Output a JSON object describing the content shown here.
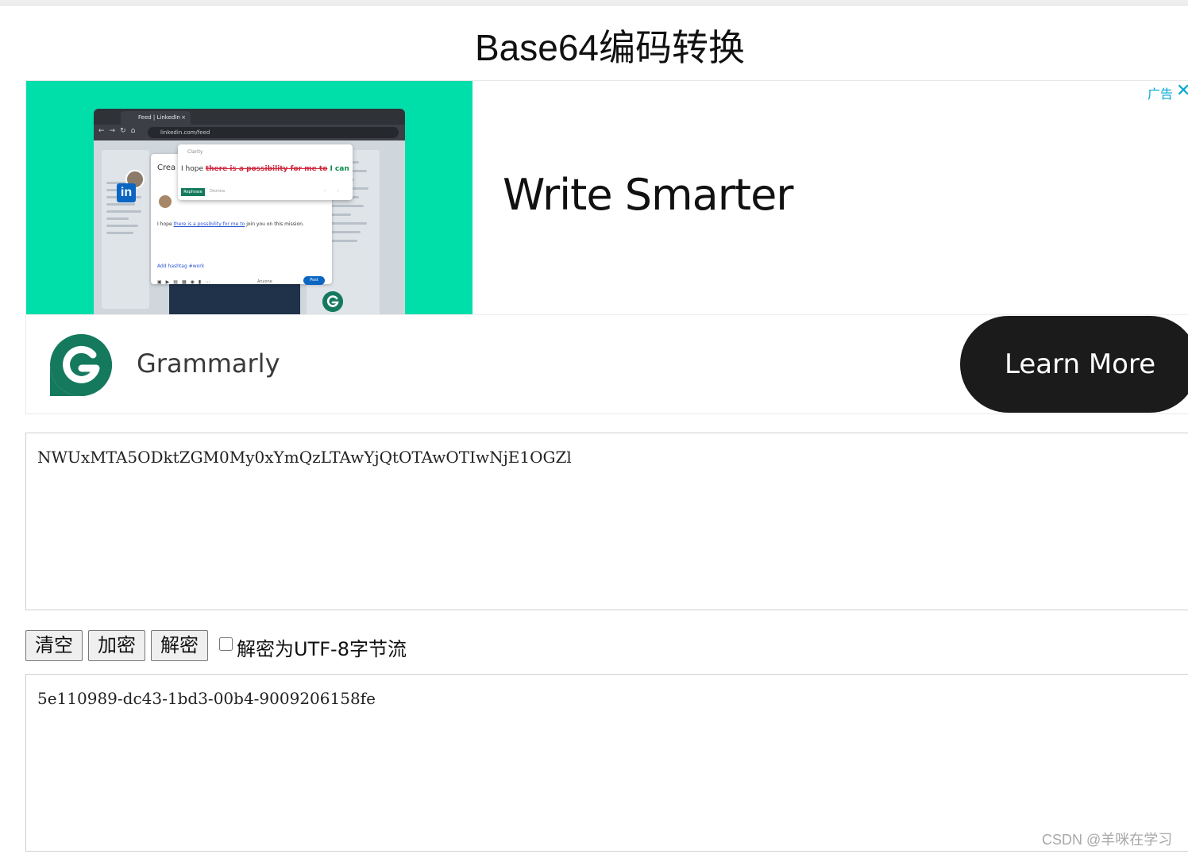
{
  "page": {
    "title": "Base64编码转换"
  },
  "ad": {
    "label": "广告",
    "close": "✕",
    "headline": "Write Smarter",
    "brand": "Grammarly",
    "cta": "Learn More",
    "colors": {
      "image_bg": "#00dfa9",
      "cta_bg": "#1b1b1b",
      "brand_green": "#15795e",
      "label_color": "#00a6d6"
    },
    "mockup": {
      "tab_title": "Feed | LinkedIn",
      "tab_close": "×",
      "url": "linkedin.com/feed",
      "linkedin_logo": "in",
      "card_prefix": "Crea",
      "clarity_label": "Clarity",
      "suggestion_prefix": "I hope ",
      "suggestion_struck": "there is a possibility for me to",
      "suggestion_replacement": " I can",
      "rephrase_label": "Rephrase",
      "dismiss_label": "Dismiss",
      "post_text_prefix": "I hope ",
      "post_text_underlined": "there is a possibility for me to",
      "post_text_suffix": " join you on this mission.",
      "hashtags": "Add hashtag   #work",
      "audience": "Anyone",
      "post_button": "Post"
    }
  },
  "input": {
    "value": "NWUxMTA5ODktZGM0My0xYmQzLTAwYjQtOTAwOTIwNjE1OGZl"
  },
  "controls": {
    "clear_label": "清空",
    "encrypt_label": "加密",
    "decrypt_label": "解密",
    "utf8_label": "解密为UTF-8字节流",
    "utf8_checked": false
  },
  "output": {
    "value": "5e110989-dc43-1bd3-00b4-9009206158fe"
  },
  "watermark": "CSDN @羊咪在学习"
}
